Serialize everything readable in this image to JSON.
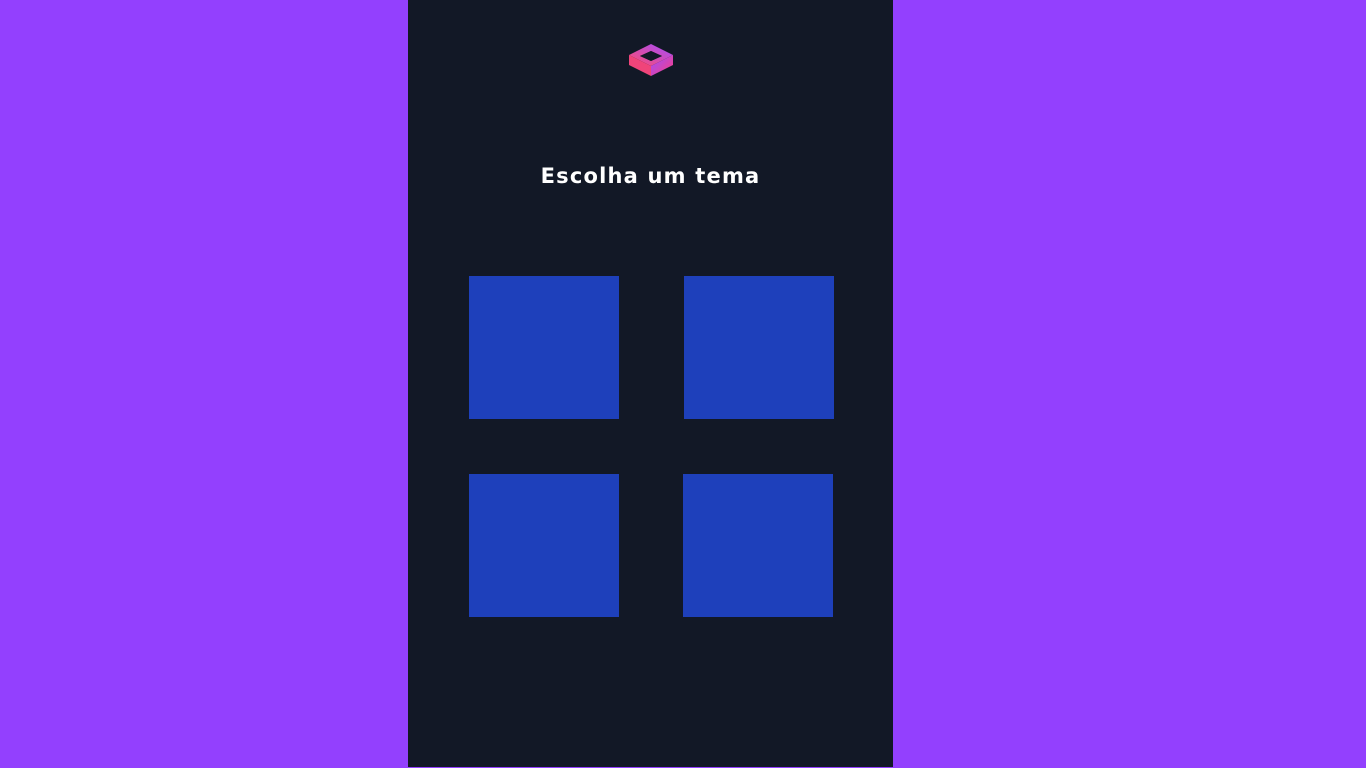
{
  "colors": {
    "background": "#9340fe",
    "panel": "#121826",
    "tile": "#1e40bb",
    "title_text": "#ffffff",
    "logo_gradient": [
      "#ff4d6d",
      "#a24bff"
    ]
  },
  "logo": {
    "icon": "cube-logo-icon"
  },
  "heading": {
    "title": "Escolha um tema"
  },
  "theme_options": [
    {
      "id": "theme-1"
    },
    {
      "id": "theme-2"
    },
    {
      "id": "theme-3"
    },
    {
      "id": "theme-4"
    }
  ]
}
